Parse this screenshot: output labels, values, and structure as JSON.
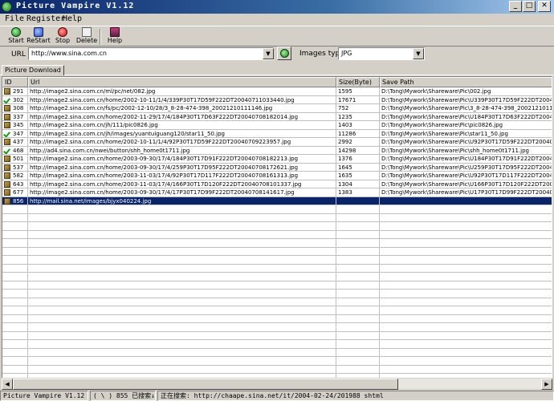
{
  "window": {
    "title": "Picture Vampire V1.12"
  },
  "menu": [
    "File",
    "Register",
    "Help"
  ],
  "toolbar": {
    "start": "Start",
    "restart": "ReStart",
    "stop": "Stop",
    "delete": "Delete",
    "help": "Help"
  },
  "url": {
    "label": "URL",
    "value": "http://www.sina.com.cn"
  },
  "images_type": {
    "label": "Images type",
    "value": "JPG"
  },
  "tab": {
    "label": "Picture Download"
  },
  "columns": {
    "id": "ID",
    "url": "Url",
    "size": "Size(Byte)",
    "save_path": "Save Path"
  },
  "rows": [
    {
      "status": "image",
      "id": "291",
      "url": "http://image2.sina.com.cn/ml/pc/net/082.jpg",
      "size": "1595",
      "path": "D:\\Tong\\Mywork\\Shareware\\Pic\\002.jpg"
    },
    {
      "status": "done",
      "id": "302",
      "url": "http://image2.sina.com.cn/home/2002-10-11/1/4/339P30T17D59F222DT20040711033440.jpg",
      "size": "17671",
      "path": "D:\\Tong\\Mywork\\Shareware\\Pic\\U339P30T17D59F222DT2004"
    },
    {
      "status": "image",
      "id": "308",
      "url": "http://image2.sina.com.cn/fs/pc/2002-12-10/28/3_8-28-474-398_20021210111146.jpg",
      "size": "752",
      "path": "D:\\Tong\\Mywork\\Shareware\\Pic\\3_8-28-474-398_20021210111"
    },
    {
      "status": "image",
      "id": "337",
      "url": "http://image2.sina.com.cn/home/2002-11-29/17/4/184P30T17D63F222DT20040708182014.jpg",
      "size": "1235",
      "path": "D:\\Tong\\Mywork\\Shareware\\Pic\\U184P30T17D63F222DT2004"
    },
    {
      "status": "image",
      "id": "345",
      "url": "http://image2.sina.com.cn/jh/111/pic0826.jpg",
      "size": "1403",
      "path": "D:\\Tong\\Mywork\\Shareware\\Pic\\pic0826.jpg"
    },
    {
      "status": "done",
      "id": "347",
      "url": "http://image2.sina.com.cn/jh/images/yuantuiguang120/star11_50.jpg",
      "size": "11286",
      "path": "D:\\Tong\\Mywork\\Shareware\\Pic\\star11_50.jpg"
    },
    {
      "status": "image",
      "id": "437",
      "url": "http://image2.sina.com.cn/home/2002-10-11/1/4/92P30T17D59F222DT20040709223957.jpg",
      "size": "2992",
      "path": "D:\\Tong\\Mywork\\Shareware\\Pic\\U92P30T17D59F222DT20040"
    },
    {
      "status": "done",
      "id": "468",
      "url": "http://ad4.sina.com.cn/nwei/button/shh_home0t1711.jpg",
      "size": "14298",
      "path": "D:\\Tong\\Mywork\\Shareware\\Pic\\shh_home0t1711.jpg"
    },
    {
      "status": "image",
      "id": "501",
      "url": "http://image2.sina.com.cn/home/2003-09-30/17/4/184P30T17D91F222DT20040708182213.jpg",
      "size": "1376",
      "path": "D:\\Tong\\Mywork\\Shareware\\Pic\\U184P30T17D91F222DT2004"
    },
    {
      "status": "image",
      "id": "537",
      "url": "http://image2.sina.com.cn/home/2003-09-30/17/4/259P30T17D95F222DT20040708172621.jpg",
      "size": "1645",
      "path": "D:\\Tong\\Mywork\\Shareware\\Pic\\U259P30T17D95F222DT2004"
    },
    {
      "status": "image",
      "id": "582",
      "url": "http://image2.sina.com.cn/home/2003-11-03/17/4/92P30T17D117F222DT20040708161313.jpg",
      "size": "1635",
      "path": "D:\\Tong\\Mywork\\Shareware\\Pic\\U92P30T17D117F222DT2004"
    },
    {
      "status": "image",
      "id": "643",
      "url": "http://image2.sina.com.cn/home/2003-11-03/17/4/166P30T17D120F222DT20040708101337.jpg",
      "size": "1304",
      "path": "D:\\Tong\\Mywork\\Shareware\\Pic\\U166P30T17D120F222DT200"
    },
    {
      "status": "image",
      "id": "677",
      "url": "http://image2.sina.com.cn/home/2003-09-30/17/4/17P30T17D99F222DT20040708141617.jpg",
      "size": "1383",
      "path": "D:\\Tong\\Mywork\\Shareware\\Pic\\U17P30T17D99F222DT20040"
    },
    {
      "status": "image",
      "id": "856",
      "url": "http://mail.sina.net/images/bjyx040224.jpg",
      "size": "",
      "path": "",
      "selected": true
    }
  ],
  "status_bar": {
    "app": "Picture Vampire V1.12",
    "progress": "( \\ )  855 已搜索↓",
    "searching": "正在搜索: http://chaape.sina.net/it/2004-02-24/201988 shtml"
  }
}
